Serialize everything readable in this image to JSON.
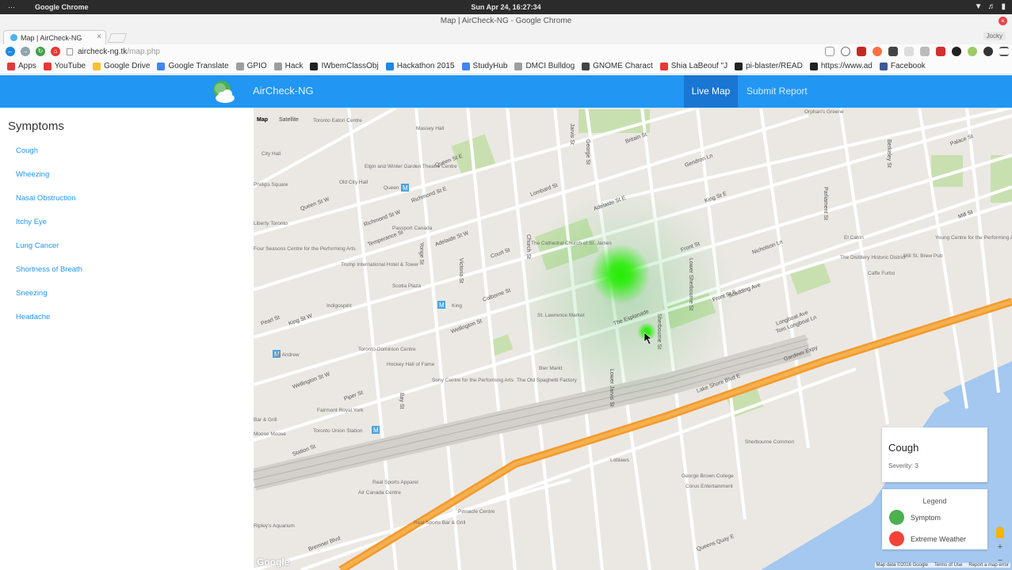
{
  "os": {
    "menu_dots": "⋯",
    "app_name": "Google Chrome",
    "clock": "Sun Apr 24, 16:27:34"
  },
  "browser": {
    "window_title": "Map | AirCheck-NG - Google Chrome",
    "tab_title": "Map | AirCheck-NG",
    "tab_close": "×",
    "profile": "Jocky",
    "url_host": "aircheck-ng.tk",
    "url_path": "/map.php",
    "bookmarks": [
      {
        "label": "Apps",
        "color": "#e53935"
      },
      {
        "label": "YouTube",
        "color": "#e53935"
      },
      {
        "label": "Google Drive",
        "color": "#fbc02d"
      },
      {
        "label": "Google Translate",
        "color": "#4285f4"
      },
      {
        "label": "GPIO",
        "color": "#9e9e9e"
      },
      {
        "label": "Hack",
        "color": "#9e9e9e"
      },
      {
        "label": "IWbemClassObj",
        "color": "#222222"
      },
      {
        "label": "Hackathon 2015",
        "color": "#1e88e5"
      },
      {
        "label": "StudyHub",
        "color": "#4285f4"
      },
      {
        "label": "DMCI Bulldog",
        "color": "#9e9e9e"
      },
      {
        "label": "GNOME Charact",
        "color": "#444444"
      },
      {
        "label": "Shia LaBeouf \"J",
        "color": "#e53935"
      },
      {
        "label": "pi-blaster/READ",
        "color": "#222222"
      },
      {
        "label": "https://www.ad",
        "color": "#222222"
      },
      {
        "label": "Facebook",
        "color": "#3b5998"
      }
    ]
  },
  "app": {
    "brand": "AirCheck-NG",
    "nav_live": "Live Map",
    "nav_report": "Submit Report"
  },
  "sidebar": {
    "title": "Symptoms",
    "items": [
      "Cough",
      "Wheezing",
      "Nasal Obstruction",
      "Itchy Eye",
      "Lung Cancer",
      "Shortness of Breath",
      "Sneezing",
      "Headache"
    ]
  },
  "map": {
    "type_map": "Map",
    "type_satellite": "Satellite",
    "google": "Google",
    "copyright": "Map data ©2016 Google",
    "terms": "Terms of Use",
    "report": "Report a map error",
    "zoom_in": "+",
    "zoom_out": "−",
    "info": {
      "title": "Cough",
      "severity": "Severity: 3"
    },
    "legend": {
      "title": "Legend",
      "items": [
        {
          "label": "Symptom",
          "color": "#4caf50"
        },
        {
          "label": "Extreme Weather",
          "color": "#f44336"
        }
      ]
    },
    "streets": [
      "Queen St W",
      "Queen St E",
      "Richmond St W",
      "Richmond St E",
      "Adelaide St W",
      "Adelaide St E",
      "King St W",
      "King St E",
      "Wellington St W",
      "Wellington St",
      "Front St E",
      "Front St",
      "Lombard St",
      "Colborne St",
      "Court St",
      "The Esplanade",
      "Lake Shore Blvd E",
      "Gardiner Expy",
      "Queens Quay E",
      "Bremner Blvd",
      "Station St",
      "Lower Jarvis St",
      "Jarvis St",
      "Church St",
      "Yonge St",
      "Bay St",
      "Victoria St",
      "Temperance St",
      "Pearl St",
      "Piper St",
      "Britain St",
      "Gendron Ln",
      "Nicholson Ln",
      "Scadding Ave",
      "Longboat Ave",
      "Tom Longboat Ln",
      "Mill St",
      "Palace St",
      "Sherbourne St",
      "Lower Sherbourne St",
      "George St",
      "Berkeley St",
      "Parliament St"
    ],
    "pois": [
      "Toronto Eaton Centre",
      "Massey Hall",
      "Old City Hall",
      "Elgin and Winter Garden Theatre Centre",
      "Passport Canada",
      "Four Seasons Centre for the Performing Arts",
      "Trump International Hotel & Tower",
      "Scotia Plaza",
      "Indigospirit",
      "The Cathedral Church of St. James",
      "St. Lawrence Market",
      "Toronto-Dominion Centre",
      "Hockey Hall of Fame",
      "Sony Centre for the Performing Arts",
      "Bier Markt",
      "The Old Spaghetti Factory",
      "Fairmont Royal York",
      "Toronto Union Station",
      "Real Sports Apparel",
      "Air Canada Centre",
      "Real Sports Bar & Grill",
      "Pinnacle Centre",
      "Loblaws",
      "George Brown College",
      "Corus Entertainment",
      "Sherbourne Common",
      "El Catrin",
      "Young Centre for the Performing Arts",
      "The Distillery Historic District",
      "Mill St. Brew Pub",
      "Caffe Furbo",
      "St Andrew",
      "King",
      "Queen",
      "Orphan's Greene",
      "Ripley's Aquarium",
      "Moose Moose",
      "Bar & Grill",
      "City Hall",
      "Phillips Square",
      "Liberty Toronto"
    ],
    "heat_color": "#22ee00"
  }
}
